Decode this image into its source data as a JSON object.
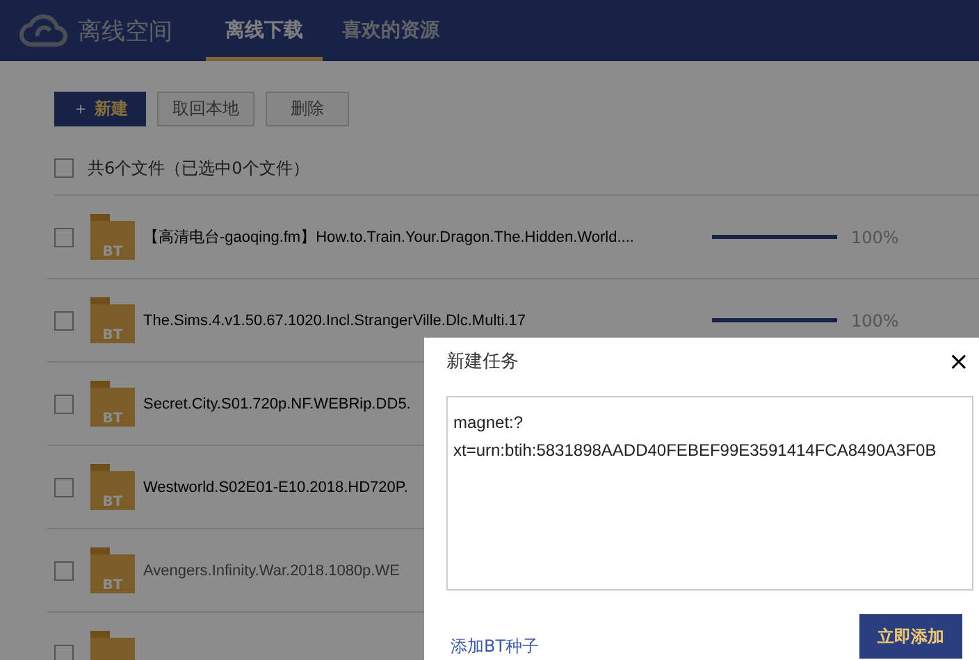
{
  "header": {
    "brand": "离线空间",
    "tabs": [
      {
        "label": "离线下载",
        "selected": true
      },
      {
        "label": "喜欢的资源",
        "selected": false
      }
    ]
  },
  "toolbar": {
    "buttons": [
      {
        "label": "新建",
        "icon": "＋",
        "disabled": false
      },
      {
        "label": "取回本地",
        "disabled": true
      },
      {
        "label": "删除",
        "disabled": true
      }
    ]
  },
  "list": {
    "summary": "共6个文件（已选中0个文件）",
    "select_all": false,
    "files": [
      {
        "name": "【高清电台-gaoqing.fm】How.to.Train.Your.Dragon.The.Hidden.World....",
        "badge": "BT",
        "checked": false,
        "faded": false,
        "level": 1,
        "reading": "100%"
      },
      {
        "name": "The.Sims.4.v1.50.67.1020.Incl.StrangerVille.Dlc.Multi.17",
        "badge": "BT",
        "checked": false,
        "faded": false,
        "level": 1,
        "reading": "100%"
      },
      {
        "name": "Secret.City.S01.720p.NF.WEBRip.DD5.",
        "badge": "BT",
        "checked": false,
        "faded": false
      },
      {
        "name": "Westworld.S02E01-E10.2018.HD720P.",
        "badge": "BT",
        "checked": false,
        "faded": false
      },
      {
        "name": "Avengers.Infinity.War.2018.1080p.WE",
        "badge": "BT",
        "checked": false,
        "faded": true
      },
      {
        "checked": false
      }
    ]
  },
  "dialog": {
    "title": "新建任务",
    "close": "×",
    "value": "magnet:?xt=urn:btih:5831898AADD40FEBEF99E3591414FCA8490A3F0B",
    "link": "添加BT种子",
    "submit": "立即添加"
  }
}
